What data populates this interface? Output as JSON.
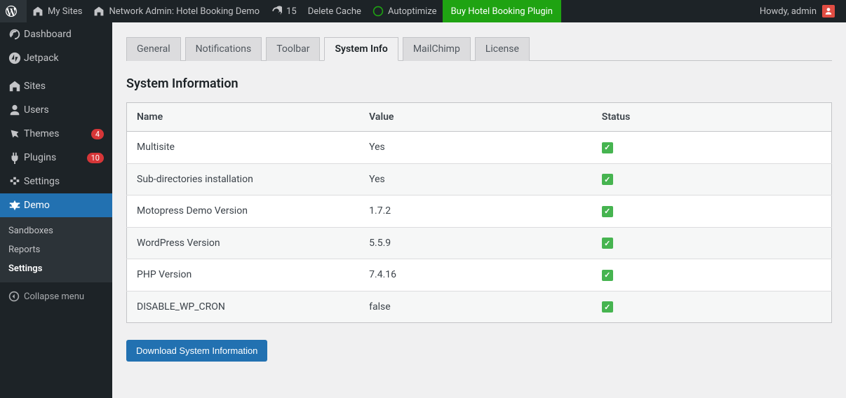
{
  "adminbar": {
    "my_sites": "My Sites",
    "network_admin": "Network Admin: Hotel Booking Demo",
    "refresh_count": "15",
    "delete_cache": "Delete Cache",
    "autoptimize": "Autoptimize",
    "buy_plugin": "Buy Hotel Booking Plugin",
    "howdy": "Howdy, admin"
  },
  "sidebar": {
    "dashboard": "Dashboard",
    "jetpack": "Jetpack",
    "sites": "Sites",
    "users": "Users",
    "themes": "Themes",
    "themes_badge": "4",
    "plugins": "Plugins",
    "plugins_badge": "10",
    "settings": "Settings",
    "demo": "Demo",
    "submenu": {
      "sandboxes": "Sandboxes",
      "reports": "Reports",
      "settings": "Settings"
    },
    "collapse": "Collapse menu"
  },
  "tabs": {
    "general": "General",
    "notifications": "Notifications",
    "toolbar": "Toolbar",
    "system_info": "System Info",
    "mailchimp": "MailChimp",
    "license": "License"
  },
  "page": {
    "heading": "System Information",
    "download_btn": "Download System Information"
  },
  "table": {
    "headers": {
      "name": "Name",
      "value": "Value",
      "status": "Status"
    },
    "rows": [
      {
        "name": "Multisite",
        "value": "Yes",
        "status": "ok"
      },
      {
        "name": "Sub-directories installation",
        "value": "Yes",
        "status": "ok"
      },
      {
        "name": "Motopress Demo Version",
        "value": "1.7.2",
        "status": "ok"
      },
      {
        "name": "WordPress Version",
        "value": "5.5.9",
        "status": "ok"
      },
      {
        "name": "PHP Version",
        "value": "7.4.16",
        "status": "ok"
      },
      {
        "name": "DISABLE_WP_CRON",
        "value": "false",
        "status": "ok"
      }
    ]
  }
}
